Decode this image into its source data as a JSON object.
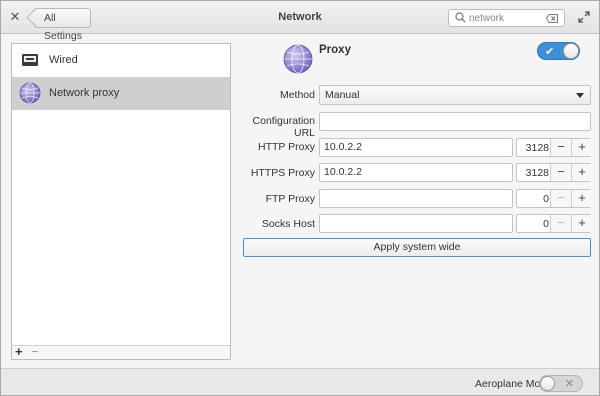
{
  "header": {
    "back_label": "All Settings",
    "title": "Network",
    "search_placeholder": "network"
  },
  "sidebar": {
    "items": [
      {
        "label": "Wired",
        "icon": "ethernet-icon",
        "selected": false
      },
      {
        "label": "Network proxy",
        "icon": "globe-icon",
        "selected": true
      }
    ],
    "add_label": "+",
    "remove_label": "−"
  },
  "proxy": {
    "title": "Proxy",
    "enabled": true,
    "method_label": "Method",
    "method_value": "Manual",
    "config_url_label": "Configuration URL",
    "config_url_value": "",
    "http_label": "HTTP Proxy",
    "http_host": "10.0.2.2",
    "http_port": "3128",
    "https_label": "HTTPS Proxy",
    "https_host": "10.0.2.2",
    "https_port": "3128",
    "ftp_label": "FTP Proxy",
    "ftp_host": "",
    "ftp_port": "0",
    "socks_label": "Socks Host",
    "socks_host": "",
    "socks_port": "0",
    "apply_label": "Apply system wide"
  },
  "footer": {
    "aeroplane_label": "Aeroplane Mode",
    "aeroplane_enabled": false
  },
  "colors": {
    "accent": "#3d8fd6",
    "selected_row": "#cfcfcf"
  }
}
